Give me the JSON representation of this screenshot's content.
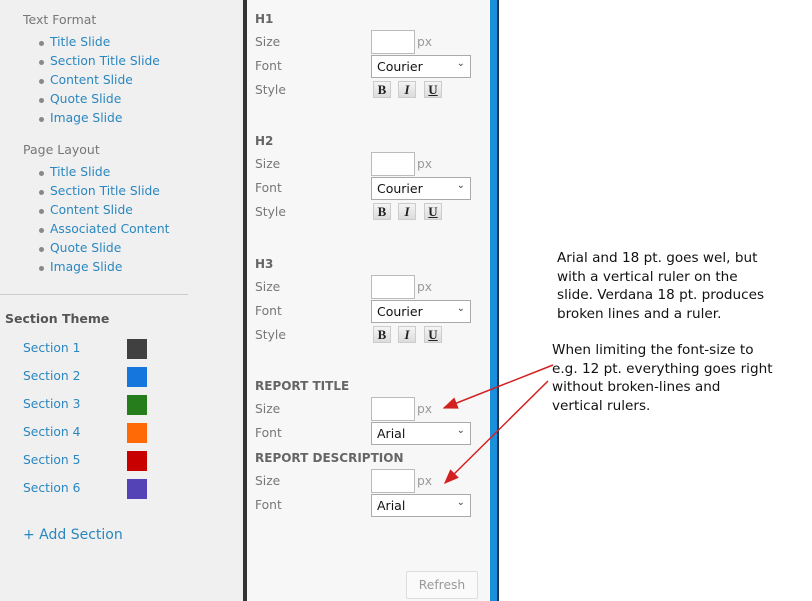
{
  "sidebar": {
    "text_format": {
      "label": "Text Format",
      "items": [
        "Title Slide",
        "Section Title Slide",
        "Content Slide",
        "Quote Slide",
        "Image Slide"
      ]
    },
    "page_layout": {
      "label": "Page Layout",
      "items": [
        "Title Slide",
        "Section Title Slide",
        "Content Slide",
        "Associated Content",
        "Quote Slide",
        "Image Slide"
      ]
    },
    "section_theme": {
      "label": "Section Theme",
      "sections": [
        {
          "label": "Section 1",
          "color": "#404040"
        },
        {
          "label": "Section 2",
          "color": "#1577de"
        },
        {
          "label": "Section 3",
          "color": "#257d1c"
        },
        {
          "label": "Section 4",
          "color": "#ff6a07"
        },
        {
          "label": "Section 5",
          "color": "#c90000"
        },
        {
          "label": "Section 6",
          "color": "#5443b6"
        }
      ],
      "add_label": "+ Add Section"
    }
  },
  "panel": {
    "labels": {
      "size": "Size",
      "font": "Font",
      "style": "Style",
      "unit": "px"
    },
    "style_buttons": {
      "bold": "B",
      "italic": "I",
      "underline": "U"
    },
    "h1": {
      "title": "H1",
      "size": "",
      "font": "Courier"
    },
    "h2": {
      "title": "H2",
      "size": "",
      "font": "Courier"
    },
    "h3": {
      "title": "H3",
      "size": "",
      "font": "Courier"
    },
    "report_title": {
      "title": "REPORT TITLE",
      "size": "",
      "font": "Arial"
    },
    "report_description": {
      "title": "REPORT DESCRIPTION",
      "size": "",
      "font": "Arial"
    },
    "refresh_label": "Refresh"
  },
  "annotations": {
    "note1": [
      "Arial and 18 pt. goes wel, but",
      "with a vertical ruler on the",
      "slide. Verdana 18 pt. produces",
      "broken lines and a ruler."
    ],
    "note2": [
      "When limiting the font-size to",
      "e.g. 12 pt. everything goes right",
      "without broken-lines and",
      "vertical rulers."
    ],
    "arrow_color": "#d42020"
  },
  "colors": {
    "accent_bar": "#1a8fdc",
    "divider": "#1c3550"
  }
}
